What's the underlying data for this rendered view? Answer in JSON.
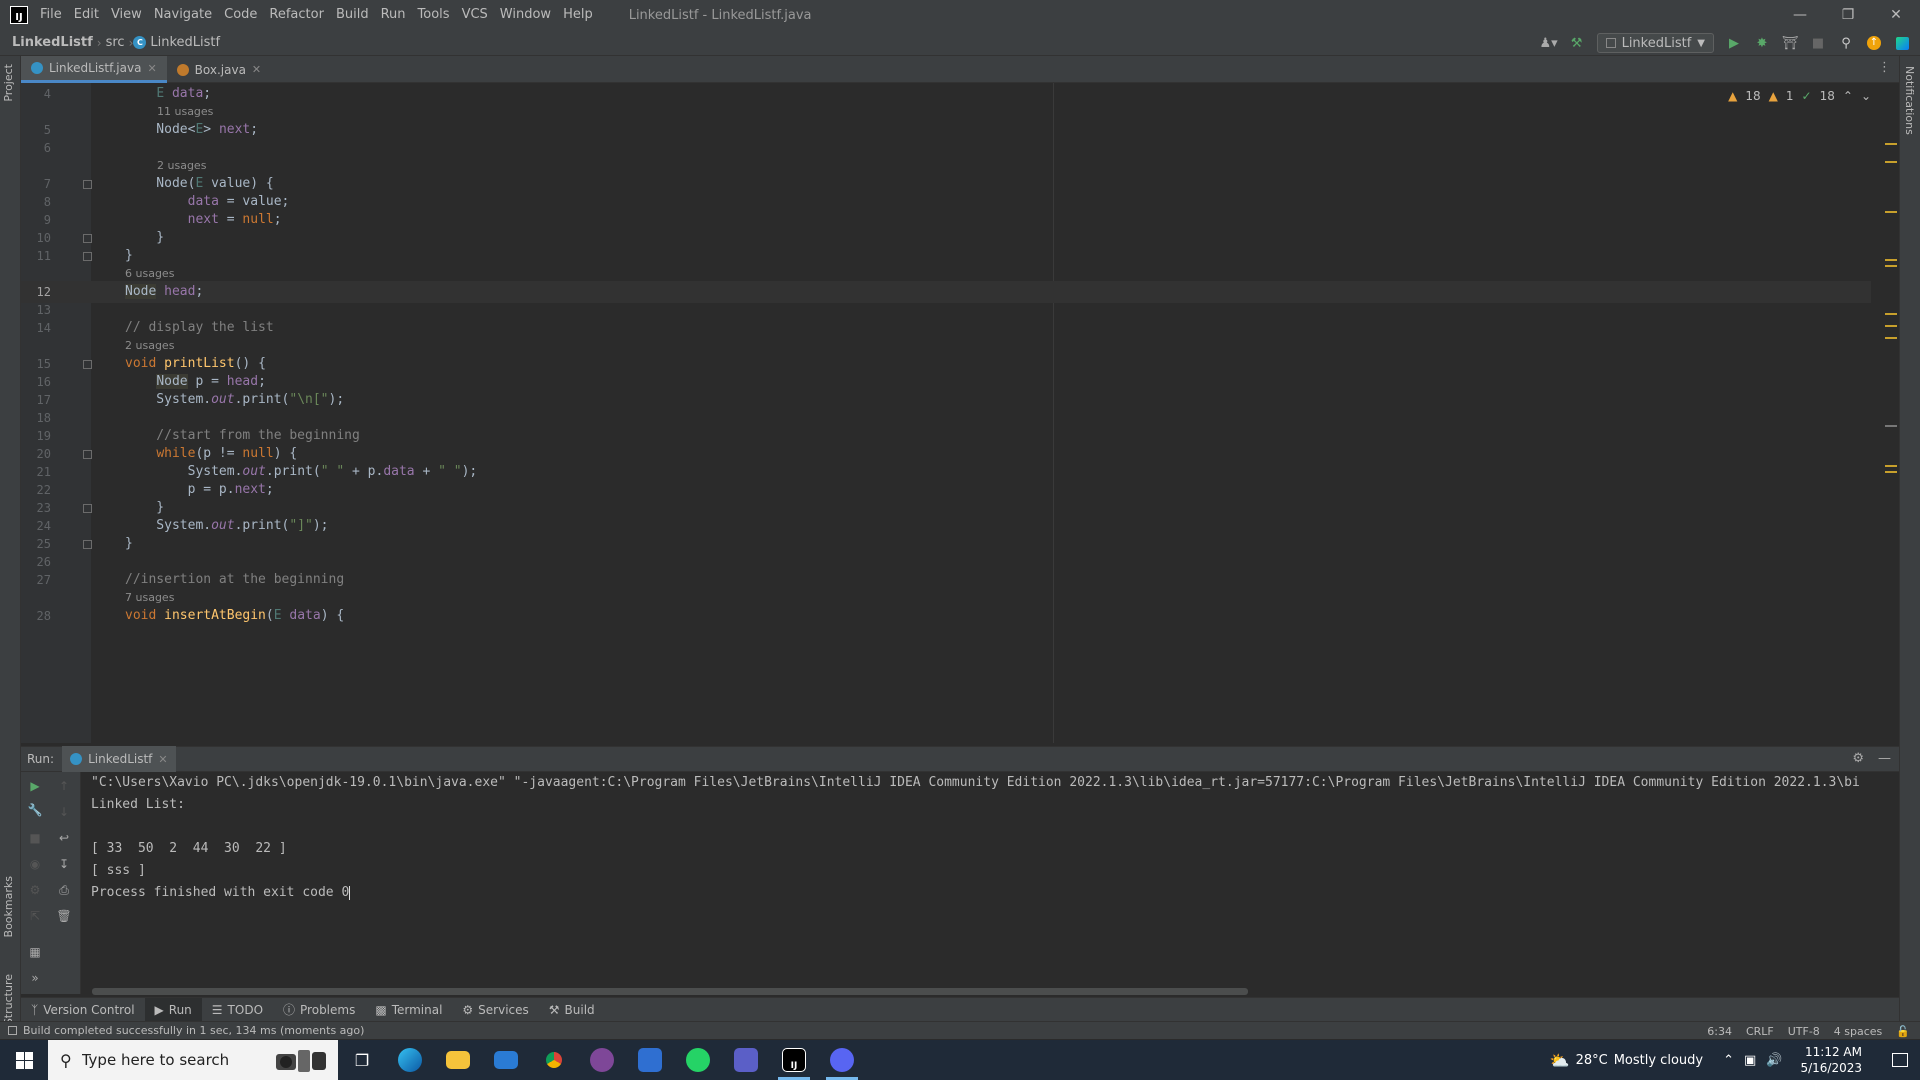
{
  "menu": {
    "items": [
      "File",
      "Edit",
      "View",
      "Navigate",
      "Code",
      "Refactor",
      "Build",
      "Run",
      "Tools",
      "VCS",
      "Window",
      "Help"
    ],
    "window_title": "LinkedListf - LinkedListf.java"
  },
  "nav": {
    "project": "LinkedListf",
    "src": "src",
    "file": "LinkedListf",
    "run_config": "LinkedListf"
  },
  "tabs": [
    {
      "label": "LinkedListf.java",
      "active": true
    },
    {
      "label": "Box.java",
      "active": false
    }
  ],
  "left_strip": {
    "project": "Project",
    "bookmarks": "Bookmarks",
    "structure": "Structure"
  },
  "right_strip": {
    "notifications": "Notifications"
  },
  "inspections": {
    "warnings": "18",
    "weak": "1",
    "ok": "18"
  },
  "editor": {
    "lines": [
      {
        "ln": "4",
        "usage": "",
        "code": "    E data;"
      },
      {
        "ln": "5",
        "usage": "11 usages",
        "code": "    Node<E> next;"
      },
      {
        "ln": "6",
        "usage": "",
        "code": ""
      },
      {
        "ln": "7",
        "usage": "2 usages",
        "code": "    Node(E value) {"
      },
      {
        "ln": "8",
        "usage": "",
        "code": "        data = value;"
      },
      {
        "ln": "9",
        "usage": "",
        "code": "        next = null;"
      },
      {
        "ln": "10",
        "usage": "",
        "code": "    }"
      },
      {
        "ln": "11",
        "usage": "",
        "code": "}"
      },
      {
        "ln": "12",
        "usage": "6 usages",
        "code": "Node head;"
      },
      {
        "ln": "13",
        "usage": "",
        "code": ""
      },
      {
        "ln": "14",
        "usage": "",
        "code": "// display the list"
      },
      {
        "ln": "15",
        "usage": "2 usages",
        "code": "void printList() {"
      },
      {
        "ln": "16",
        "usage": "",
        "code": "    Node p = head;"
      },
      {
        "ln": "17",
        "usage": "",
        "code": "    System.out.print(\"\\n[\");"
      },
      {
        "ln": "18",
        "usage": "",
        "code": ""
      },
      {
        "ln": "19",
        "usage": "",
        "code": "    //start from the beginning"
      },
      {
        "ln": "20",
        "usage": "",
        "code": "    while(p != null) {"
      },
      {
        "ln": "21",
        "usage": "",
        "code": "        System.out.print(\" \" + p.data + \" \");"
      },
      {
        "ln": "22",
        "usage": "",
        "code": "        p = p.next;"
      },
      {
        "ln": "23",
        "usage": "",
        "code": "    }"
      },
      {
        "ln": "24",
        "usage": "",
        "code": "    System.out.print(\"]\");"
      },
      {
        "ln": "25",
        "usage": "",
        "code": "}"
      },
      {
        "ln": "26",
        "usage": "",
        "code": ""
      },
      {
        "ln": "27",
        "usage": "",
        "code": "//insertion at the beginning"
      },
      {
        "ln": "28",
        "usage": "7 usages",
        "code": "void insertAtBegin(E data) {"
      }
    ]
  },
  "run": {
    "label": "Run:",
    "tab": "LinkedListf",
    "console": [
      "\"C:\\Users\\Xavio PC\\.jdks\\openjdk-19.0.1\\bin\\java.exe\" \"-javaagent:C:\\Program Files\\JetBrains\\IntelliJ IDEA Community Edition 2022.1.3\\lib\\idea_rt.jar=57177:C:\\Program Files\\JetBrains\\IntelliJ IDEA Community Edition 2022.1.3\\bi",
      "Linked List:",
      "",
      "[ 33  50  2  44  30  22 ]",
      "[ sss ]",
      "Process finished with exit code 0"
    ]
  },
  "tool_tabs": [
    "Version Control",
    "Run",
    "TODO",
    "Problems",
    "Terminal",
    "Services",
    "Build"
  ],
  "status": {
    "message": "Build completed successfully in 1 sec, 134 ms (moments ago)",
    "position": "6:34",
    "line_sep": "CRLF",
    "encoding": "UTF-8",
    "indent": "4 spaces"
  },
  "taskbar": {
    "search_placeholder": "Type here to search",
    "temperature": "28°C",
    "weather": "Mostly cloudy",
    "time": "11:12 AM",
    "date": "5/16/2023"
  }
}
